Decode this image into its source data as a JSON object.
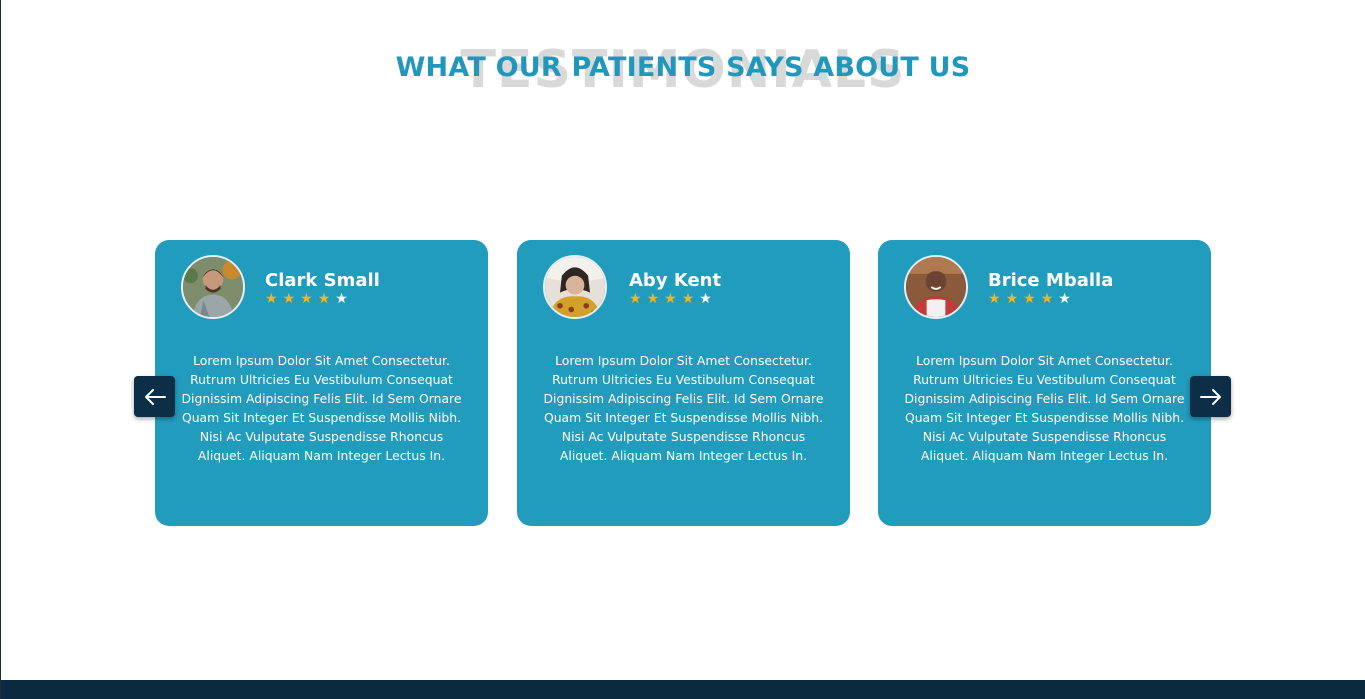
{
  "section": {
    "background_word": "TESTIMONIALS",
    "title": "WHAT OUR PATIENTS SAYS ABOUT US"
  },
  "colors": {
    "accent": "#2197bb",
    "card_bg": "#229cbd",
    "star": "#f6b51e",
    "nav_button": "#0c2f47",
    "footer": "#0b2a40"
  },
  "testimonials": [
    {
      "name": "Clark Small",
      "rating": 4,
      "out_of": 5,
      "text": "Lorem Ipsum Dolor Sit Amet Consectetur. Rutrum Ultricies Eu Vestibulum Consequat Dignissim Adipiscing Felis Elit. Id Sem Ornare Quam Sit Integer Et Suspendisse Mollis Nibh. Nisi Ac Vulputate Suspendisse Rhoncus Aliquet. Aliquam Nam Integer Lectus In."
    },
    {
      "name": "Aby Kent",
      "rating": 4,
      "out_of": 5,
      "text": "Lorem Ipsum Dolor Sit Amet Consectetur. Rutrum Ultricies Eu Vestibulum Consequat Dignissim Adipiscing Felis Elit. Id Sem Ornare Quam Sit Integer Et Suspendisse Mollis Nibh. Nisi Ac Vulputate Suspendisse Rhoncus Aliquet. Aliquam Nam Integer Lectus In."
    },
    {
      "name": "Brice Mballa",
      "rating": 4,
      "out_of": 5,
      "text": "Lorem Ipsum Dolor Sit Amet Consectetur. Rutrum Ultricies Eu Vestibulum Consequat Dignissim Adipiscing Felis Elit. Id Sem Ornare Quam Sit Integer Et Suspendisse Mollis Nibh. Nisi Ac Vulputate Suspendisse Rhoncus Aliquet. Aliquam Nam Integer Lectus In."
    }
  ],
  "icons": {
    "prev": "arrow-left-icon",
    "next": "arrow-right-icon",
    "star": "star-icon"
  }
}
